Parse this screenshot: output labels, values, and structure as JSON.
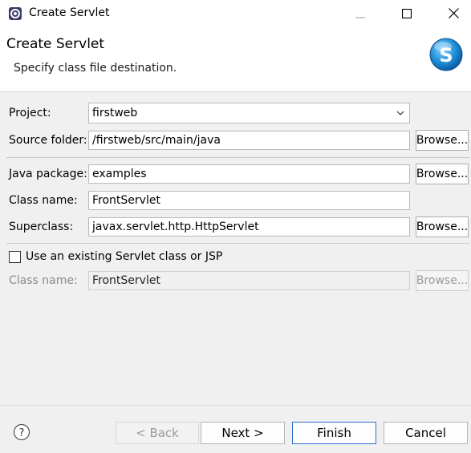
{
  "window": {
    "title": "Create Servlet",
    "icon": "eclipse-icon"
  },
  "header": {
    "title": "Create Servlet",
    "subtitle": "Specify class file destination.",
    "logo_letter": "S"
  },
  "form": {
    "project": {
      "label": "Project:",
      "value": "firstweb"
    },
    "source_folder": {
      "label": "Source folder:",
      "value": "/firstweb/src/main/java",
      "browse": "Browse..."
    },
    "java_package": {
      "label": "Java package:",
      "value": "examples",
      "browse": "Browse..."
    },
    "class_name": {
      "label": "Class name:",
      "value": "FrontServlet"
    },
    "superclass": {
      "label": "Superclass:",
      "value": "javax.servlet.http.HttpServlet",
      "browse": "Browse..."
    },
    "existing": {
      "checkbox_label": "Use an existing Servlet class or JSP",
      "checked": false
    },
    "existing_class_name": {
      "label": "Class name:",
      "value": "FrontServlet",
      "browse": "Browse..."
    }
  },
  "footer": {
    "help": "?",
    "back": "< Back",
    "next": "Next >",
    "finish": "Finish",
    "cancel": "Cancel"
  },
  "colors": {
    "accent": "#2b6fcf",
    "logo": "#1e90d8"
  }
}
